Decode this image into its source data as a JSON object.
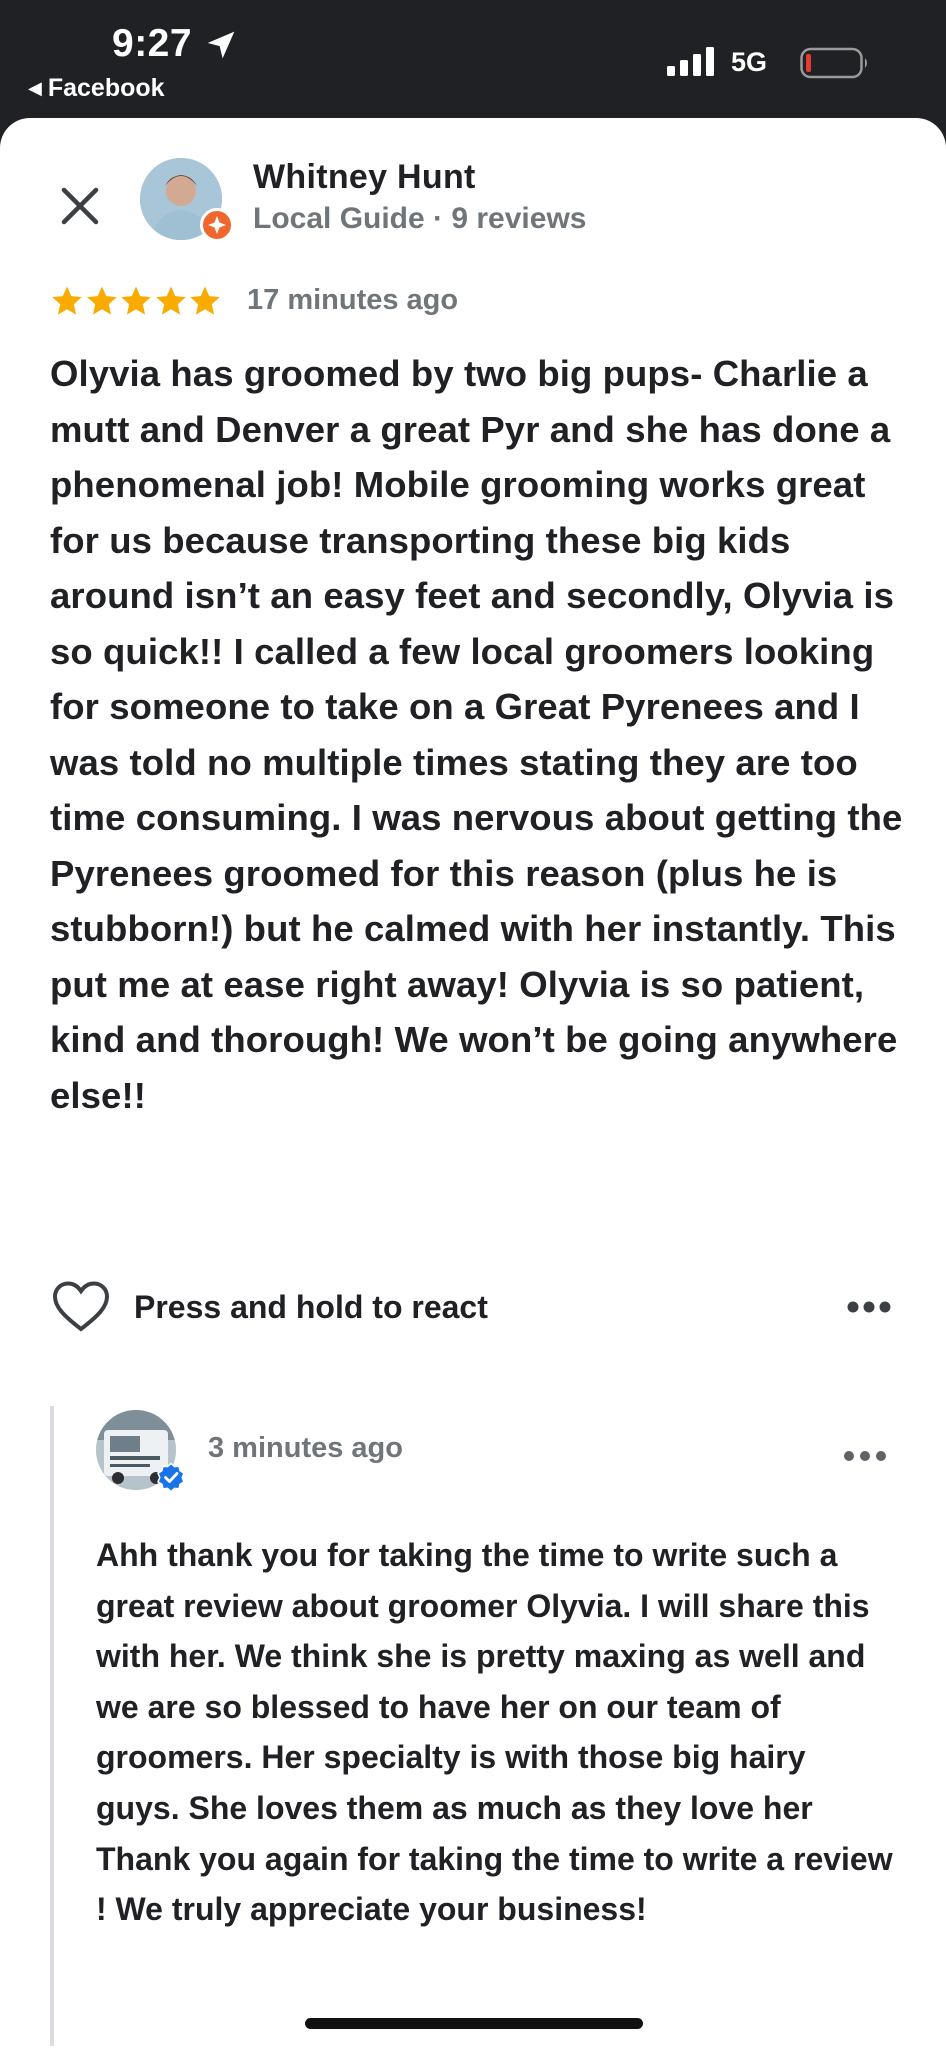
{
  "status_bar": {
    "time": "9:27",
    "back_app": "Facebook",
    "network": "5G"
  },
  "reviewer": {
    "name": "Whitney Hunt",
    "meta": "Local Guide · 9 reviews"
  },
  "review": {
    "rating": 5,
    "time": "17 minutes ago",
    "text": "Olyvia has groomed by two big pups- Charlie a mutt and Denver a great Pyr and she has done a phenomenal job! Mobile grooming works great for us because transporting these big kids around isn’t an easy feet and secondly, Olyvia is so quick!! I called a few local groomers looking for someone to take on a Great Pyrenees and I was told no multiple times stating they are too time consuming. I was nervous about getting the Pyrenees groomed for this reason (plus he is stubborn!) but he calmed with her instantly. This put me at ease right away! Olyvia is so patient, kind and thorough! We won’t be going anywhere else!!",
    "react_label": "Press and hold to react"
  },
  "owner_reply": {
    "time": "3 minutes ago",
    "text": "Ahh thank you for taking the time to write such a great review about groomer Olyvia.  I will share this with her.  We think she is pretty maxing as well and we are so blessed to have her on our team of groomers.  Her specialty is with those big hairy guys. She loves them as much as they love her    Thank you again for taking the time to write a review !   We truly appreciate your business!"
  },
  "colors": {
    "star": "#f9ab00",
    "guide_badge": "#f0672e",
    "verified": "#1a73e8",
    "secondary_text": "#70757a"
  }
}
